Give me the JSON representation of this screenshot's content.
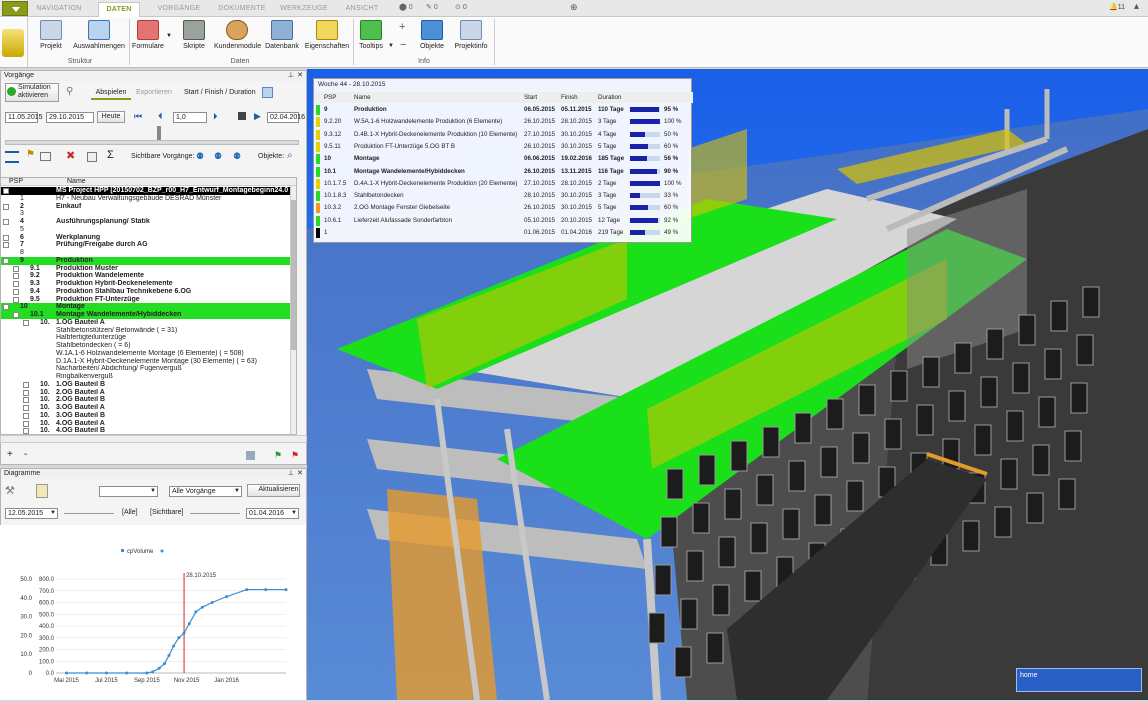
{
  "ribbon": {
    "tabs": [
      "NAVIGATION",
      "DATEN",
      "VORGÄNGE",
      "DOKUMENTE",
      "WERKZEUGE",
      "ANSICHT"
    ],
    "active_tab": "DATEN",
    "buttons": [
      "Projekt",
      "Auswahlmengen",
      "Formulare",
      "Skripte",
      "Kundenmodule",
      "Datenbank",
      "Eigenschaften",
      "Tooltips",
      "Objekte",
      "Projektinfo"
    ],
    "groups": [
      "Struktur",
      "Daten",
      "Info"
    ],
    "status": {
      "a": "0",
      "b": "0",
      "c": "0",
      "count": "11"
    }
  },
  "vorgaenge": {
    "title": "Vorgänge",
    "sim_button": "Simulation aktivieren",
    "tabs": [
      "Abspielen",
      "Exportieren"
    ],
    "mode": "Start / Finish / Duration",
    "date_start": "11.05.2015",
    "date_current": "29.10.2015",
    "today_button": "Heute",
    "speed": "1,0",
    "date_end": "02.04.2016",
    "visible_label": "Sichtbare Vorgänge:",
    "objects_label": "Objekte:",
    "col_psp": "PSP",
    "col_name": "Name",
    "rows": [
      {
        "psp": "",
        "name": "MS Project HPP [20150702_BZP_r00_H7_Entwurf_Montagebeginn24.0",
        "style": "b",
        "exp": "-",
        "indent": 0
      },
      {
        "psp": "1",
        "name": "H7 - Neubau Verwaltungsgebäude DESRAD Münster",
        "style": "",
        "exp": "",
        "indent": 0
      },
      {
        "psp": "2",
        "name": "Einkauf",
        "style": "bold",
        "exp": "+",
        "indent": 0
      },
      {
        "psp": "3",
        "name": "",
        "style": "",
        "exp": "",
        "indent": 0
      },
      {
        "psp": "4",
        "name": "Ausführungsplanung/ Statik",
        "style": "bold",
        "exp": "+",
        "indent": 0
      },
      {
        "psp": "5",
        "name": "",
        "style": "",
        "exp": "",
        "indent": 0
      },
      {
        "psp": "6",
        "name": "Werkplanung",
        "style": "bold",
        "exp": "+",
        "indent": 0
      },
      {
        "psp": "7",
        "name": "Prüfung/Freigabe durch AG",
        "style": "bold",
        "exp": "+",
        "indent": 0
      },
      {
        "psp": "8",
        "name": "",
        "style": "",
        "exp": "",
        "indent": 0
      },
      {
        "psp": "9",
        "name": "Produktion",
        "style": "g",
        "exp": "-",
        "indent": 0
      },
      {
        "psp": "9.1",
        "name": "Produktion Muster",
        "style": "bold",
        "exp": "+",
        "indent": 1
      },
      {
        "psp": "9.2",
        "name": "Produktion Wandelemente",
        "style": "bold",
        "exp": "+",
        "indent": 1
      },
      {
        "psp": "9.3",
        "name": "Produktion Hybrit-Deckenelemente",
        "style": "bold",
        "exp": "+",
        "indent": 1
      },
      {
        "psp": "9.4",
        "name": "Produktion Stahlbau Technikebene 6.OG",
        "style": "bold",
        "exp": "+",
        "indent": 1
      },
      {
        "psp": "9.5",
        "name": "Produktion FT-Unterzüge",
        "style": "bold",
        "exp": "+",
        "indent": 1
      },
      {
        "psp": "10",
        "name": "Montage",
        "style": "g",
        "exp": "-",
        "indent": 0
      },
      {
        "psp": "10.1",
        "name": "Montage Wandelemente/Hybiddecken",
        "style": "g",
        "exp": "-",
        "indent": 1
      },
      {
        "psp": "10.",
        "name": "1.OG Bauteil A",
        "style": "bold",
        "exp": "-",
        "indent": 2
      },
      {
        "psp": "",
        "name": "Stahlbetonstützen/ Betonwände ( = 31)",
        "style": "",
        "exp": "",
        "indent": 3
      },
      {
        "psp": "",
        "name": "Halbfertigteilunterzüge",
        "style": "",
        "exp": "",
        "indent": 3
      },
      {
        "psp": "",
        "name": "Stahlbetondecken ( = 6)",
        "style": "",
        "exp": "",
        "indent": 3
      },
      {
        "psp": "",
        "name": "W.1A.1-6 Holzwandelemente Montage (6 Elemente) ( = 508)",
        "style": "",
        "exp": "",
        "indent": 3
      },
      {
        "psp": "",
        "name": "D.1A.1-X Hybrit-Deckenelemente Montage (30 Elemente) ( = 63)",
        "style": "",
        "exp": "",
        "indent": 3
      },
      {
        "psp": "",
        "name": "Nacharbeiten/ Abdichtung/ Fugenverguß",
        "style": "",
        "exp": "",
        "indent": 3
      },
      {
        "psp": "",
        "name": "Ringbalkenverguß",
        "style": "",
        "exp": "",
        "indent": 3
      },
      {
        "psp": "10.",
        "name": "1.OG Bauteil B",
        "style": "bold",
        "exp": "+",
        "indent": 2
      },
      {
        "psp": "10.",
        "name": "2.OG Bauteil A",
        "style": "bold",
        "exp": "+",
        "indent": 2
      },
      {
        "psp": "10.",
        "name": "2.OG Bauteil B",
        "style": "bold",
        "exp": "+",
        "indent": 2
      },
      {
        "psp": "10.",
        "name": "3.OG Bauteil A",
        "style": "bold",
        "exp": "+",
        "indent": 2
      },
      {
        "psp": "10.",
        "name": "3.OG Bauteil B",
        "style": "bold",
        "exp": "+",
        "indent": 2
      },
      {
        "psp": "10.",
        "name": "4.OG Bauteil A",
        "style": "bold",
        "exp": "+",
        "indent": 2
      },
      {
        "psp": "10.",
        "name": "4.OG Bauteil B",
        "style": "bold",
        "exp": "+",
        "indent": 2
      }
    ]
  },
  "diagramme": {
    "title": "Diagramme",
    "filter": "Alle Vorgänge",
    "refresh": "Aktualisieren",
    "date_from": "12.05.2015",
    "all_label": "[Alle]",
    "visible_label": "[Sichtbare]",
    "date_to": "01.04.2016",
    "home_label": "home"
  },
  "overlay": {
    "title": "Woche 44 - 28.10.2015",
    "headers": [
      "PSP",
      "Name",
      "Start",
      "Finish",
      "Duration"
    ],
    "rows": [
      {
        "psp": "9",
        "name": "Produktion",
        "start": "06.05.2015",
        "finish": "05.11.2015",
        "dur": "110 Tage",
        "pct": 95,
        "pct_text": "95 %",
        "color": "#22dd22",
        "bold": true
      },
      {
        "psp": "9.2.20",
        "name": "W.5A.1-6 Holzwandelemente Produktion (6 Elemente)",
        "start": "26.10.2015",
        "finish": "28.10.2015",
        "dur": "3 Tage",
        "pct": 100,
        "pct_text": "100 %",
        "color": "#e6d200",
        "bold": false
      },
      {
        "psp": "9.3.12",
        "name": "D.4B.1-X Hybrit-Deckenelemente Produktion (10 Elemente)",
        "start": "27.10.2015",
        "finish": "30.10.2015",
        "dur": "4 Tage",
        "pct": 50,
        "pct_text": "50 %",
        "color": "#e6d200",
        "bold": false
      },
      {
        "psp": "9.5.11",
        "name": "Produktion FT-Unterzüge 5.OG BT B",
        "start": "26.10.2015",
        "finish": "30.10.2015",
        "dur": "5 Tage",
        "pct": 60,
        "pct_text": "60 %",
        "color": "#e6d200",
        "bold": false
      },
      {
        "psp": "10",
        "name": "Montage",
        "start": "06.06.2015",
        "finish": "19.02.2016",
        "dur": "185 Tage",
        "pct": 56,
        "pct_text": "56 %",
        "color": "#22dd22",
        "bold": true
      },
      {
        "psp": "10.1",
        "name": "Montage Wandelemente/Hybiddecken",
        "start": "26.10.2015",
        "finish": "13.11.2015",
        "dur": "116 Tage",
        "pct": 90,
        "pct_text": "90 %",
        "color": "#22dd22",
        "bold": true
      },
      {
        "psp": "10.1.7.5",
        "name": "D.4A.1-X Hybrit-Deckenelemente Produktion (20 Elemente)",
        "start": "27.10.2015",
        "finish": "28.10.2015",
        "dur": "2 Tage",
        "pct": 100,
        "pct_text": "100 %",
        "color": "#e6d200",
        "bold": false
      },
      {
        "psp": "10.1.8.3",
        "name": "Stahlbetondecken",
        "start": "28.10.2015",
        "finish": "30.10.2015",
        "dur": "3 Tage",
        "pct": 33,
        "pct_text": "33 %",
        "color": "#22dd22",
        "bold": false
      },
      {
        "psp": "10.3.2",
        "name": "2.OG Montage Fenster Giebelseite",
        "start": "26.10.2015",
        "finish": "30.10.2015",
        "dur": "5 Tage",
        "pct": 60,
        "pct_text": "60 %",
        "color": "#f29a1a",
        "bold": false
      },
      {
        "psp": "10.6.1",
        "name": "Lieferzeit Alufassade Sonderfarbton",
        "start": "05.10.2015",
        "finish": "20.10.2015",
        "dur": "12 Tage",
        "pct": 92,
        "pct_text": "92 %",
        "color": "#22dd22",
        "bold": false
      },
      {
        "psp": "1",
        "name": "",
        "start": "01.06.2015",
        "finish": "01.04.2016",
        "dur": "219 Tage",
        "pct": 49,
        "pct_text": "49 %",
        "color": "#000000",
        "bold": false
      }
    ]
  },
  "chart_data": {
    "type": "line",
    "legend": "cpVolume",
    "marker_label": "28.10.2015",
    "x_ticks": [
      "Mai 2015",
      "Jul 2015",
      "Sep 2015",
      "Nov 2015",
      "Jan 2016"
    ],
    "y_left_ticks": [
      "0",
      "10.0",
      "20.0",
      "30.0",
      "40.0",
      "50.0"
    ],
    "y_right_ticks": [
      "0.0",
      "100.0",
      "200.0",
      "300.0",
      "400.0",
      "500.0",
      "600.0",
      "700.0",
      "800.0"
    ],
    "x_range": [
      "2015-04-15",
      "2016-04-01"
    ],
    "y_range": [
      0,
      800
    ],
    "points": [
      {
        "x": "2015-05-01",
        "y": 0
      },
      {
        "x": "2015-06-01",
        "y": 0
      },
      {
        "x": "2015-07-01",
        "y": 0
      },
      {
        "x": "2015-08-01",
        "y": 0
      },
      {
        "x": "2015-09-01",
        "y": 0
      },
      {
        "x": "2015-09-10",
        "y": 10
      },
      {
        "x": "2015-09-20",
        "y": 40
      },
      {
        "x": "2015-09-28",
        "y": 80
      },
      {
        "x": "2015-10-05",
        "y": 150
      },
      {
        "x": "2015-10-12",
        "y": 230
      },
      {
        "x": "2015-10-20",
        "y": 300
      },
      {
        "x": "2015-10-28",
        "y": 340
      },
      {
        "x": "2015-11-05",
        "y": 420
      },
      {
        "x": "2015-11-15",
        "y": 520
      },
      {
        "x": "2015-11-25",
        "y": 560
      },
      {
        "x": "2015-12-10",
        "y": 600
      },
      {
        "x": "2016-01-01",
        "y": 650
      },
      {
        "x": "2016-02-01",
        "y": 710
      },
      {
        "x": "2016-03-01",
        "y": 710
      },
      {
        "x": "2016-04-01",
        "y": 710
      }
    ],
    "marker_x": "2015-10-28"
  },
  "colors": {
    "green": "#22dd22",
    "yellow": "#e6d200",
    "orange": "#f29a1a",
    "sky": "#1d6cf2",
    "accent": "#8c9a1a"
  }
}
